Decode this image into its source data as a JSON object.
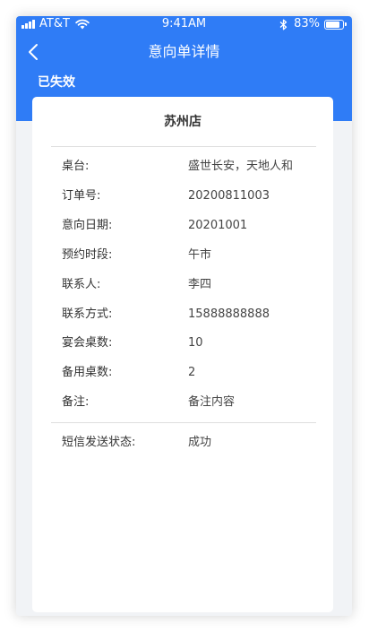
{
  "status_bar": {
    "carrier": "AT&T",
    "time": "9:41AM",
    "battery_percent": "83%",
    "battery_level": 0.83,
    "icons": [
      "signal-icon",
      "wifi-icon",
      "bluetooth-icon",
      "battery-icon"
    ]
  },
  "nav": {
    "title": "意向单详情",
    "back_icon": "chevron-left-icon"
  },
  "order_status": "已失效",
  "card": {
    "store_name": "苏州店",
    "fields": [
      {
        "label": "桌台:",
        "value": "盛世长安，天地人和"
      },
      {
        "label": "订单号:",
        "value": "20200811003"
      },
      {
        "label": "意向日期:",
        "value": "20201001"
      },
      {
        "label": "预约时段:",
        "value": "午市"
      },
      {
        "label": "联系人:",
        "value": "李四"
      },
      {
        "label": "联系方式:",
        "value": "15888888888"
      },
      {
        "label": "宴会桌数:",
        "value": "10"
      },
      {
        "label": "备用桌数:",
        "value": "2"
      },
      {
        "label": "备注:",
        "value": "备注内容"
      }
    ],
    "sms": {
      "label": "短信发送状态:",
      "value": "成功"
    }
  },
  "colors": {
    "header": "#2f7cf6",
    "background": "#f1f3f6",
    "card": "#ffffff"
  }
}
